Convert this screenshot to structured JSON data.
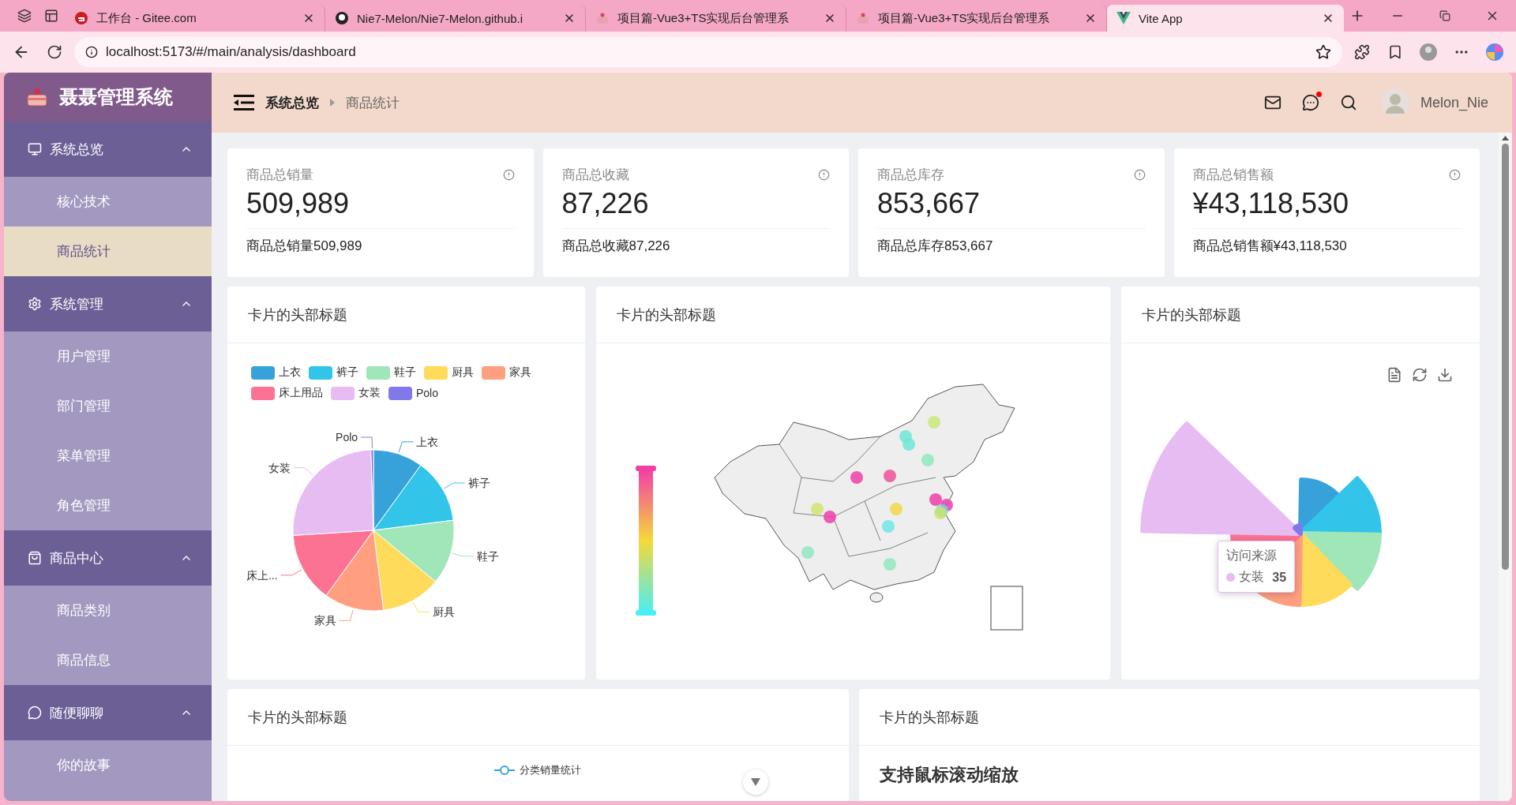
{
  "browser": {
    "tabs": [
      {
        "title": "工作台 - Gitee.com",
        "selected": false
      },
      {
        "title": "Nie7-Melon/Nie7-Melon.github.i",
        "selected": false
      },
      {
        "title": "项目篇-Vue3+TS实现后台管理系",
        "selected": false
      },
      {
        "title": "项目篇-Vue3+TS实现后台管理系",
        "selected": false
      },
      {
        "title": "Vite App",
        "selected": true
      }
    ],
    "url": "localhost:5173/#/main/analysis/dashboard"
  },
  "sidebar": {
    "title": "聂聂管理系统",
    "groups": [
      {
        "label": "系统总览",
        "expanded": true,
        "children": [
          {
            "label": "核心技术",
            "selected": false
          },
          {
            "label": "商品统计",
            "selected": true
          }
        ]
      },
      {
        "label": "系统管理",
        "expanded": true,
        "children": [
          {
            "label": "用户管理",
            "selected": false
          },
          {
            "label": "部门管理",
            "selected": false
          },
          {
            "label": "菜单管理",
            "selected": false
          },
          {
            "label": "角色管理",
            "selected": false
          }
        ]
      },
      {
        "label": "商品中心",
        "expanded": true,
        "children": [
          {
            "label": "商品类别",
            "selected": false
          },
          {
            "label": "商品信息",
            "selected": false
          }
        ]
      },
      {
        "label": "随便聊聊",
        "expanded": true,
        "children": [
          {
            "label": "你的故事",
            "selected": false
          }
        ]
      }
    ]
  },
  "header": {
    "breadcrumb": [
      "系统总览",
      "商品统计"
    ],
    "unread_messages": true,
    "user": "Melon_Nie"
  },
  "stats": [
    {
      "title": "商品总销量",
      "value": "509,989",
      "footer": "商品总销量509,989"
    },
    {
      "title": "商品总收藏",
      "value": "87,226",
      "footer": "商品总收藏87,226"
    },
    {
      "title": "商品总库存",
      "value": "853,667",
      "footer": "商品总库存853,667"
    },
    {
      "title": "商品总销售额",
      "value": "¥43,118,530",
      "footer": "商品总销售额¥43,118,530"
    }
  ],
  "pie_card": {
    "title": "卡片的头部标题",
    "items": [
      {
        "legend": "上衣",
        "label": "上衣",
        "color": "#37a2da"
      },
      {
        "legend": "裤子",
        "label": "裤子",
        "color": "#32c5e9"
      },
      {
        "legend": "鞋子",
        "label": "鞋子",
        "color": "#9fe6b8"
      },
      {
        "legend": "厨具",
        "label": "厨具",
        "color": "#ffdb5c"
      },
      {
        "legend": "家具",
        "label": "家具",
        "color": "#ff9f7f"
      },
      {
        "legend": "床上用品",
        "label": "床上...",
        "color": "#fb7293"
      },
      {
        "legend": "女装",
        "label": "女装",
        "color": "#e7bcf3"
      },
      {
        "legend": "Polo",
        "label": "Polo",
        "color": "#8378ea"
      }
    ]
  },
  "map_card": {
    "title": "卡片的头部标题"
  },
  "rose_card": {
    "title": "卡片的头部标题",
    "tooltip": {
      "title": "访问来源",
      "name": "女装",
      "value": "35",
      "color": "#e7bcf3"
    }
  },
  "line_card": {
    "title": "卡片的头部标题",
    "legend": "分类销量统计"
  },
  "zoom_card": {
    "title": "卡片的头部标题",
    "heading": "支持鼠标滚动缩放"
  }
}
